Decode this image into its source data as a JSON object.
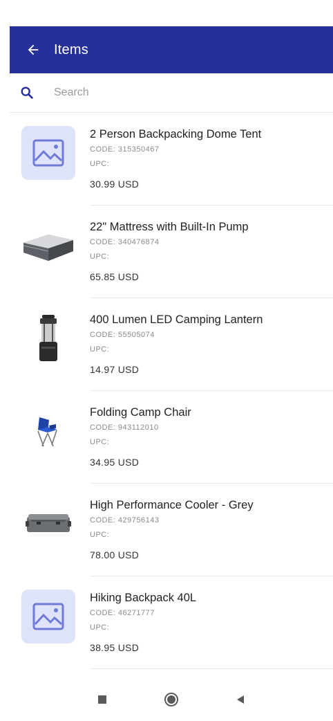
{
  "app_bar": {
    "title": "Items"
  },
  "search": {
    "placeholder": "Search"
  },
  "items": [
    {
      "name": "2 Person Backpacking Dome Tent",
      "code": "CODE: 315350467",
      "upc": "UPC:",
      "price": "30.99 USD",
      "image": "placeholder-image-icon"
    },
    {
      "name": "22\" Mattress with Built-In Pump",
      "code": "CODE: 340476874",
      "upc": "UPC:",
      "price": "65.85 USD",
      "image": "mattress-photo"
    },
    {
      "name": "400 Lumen LED Camping Lantern",
      "code": "CODE: 55505074",
      "upc": "UPC:",
      "price": "14.97 USD",
      "image": "lantern-photo"
    },
    {
      "name": "Folding Camp Chair",
      "code": "CODE: 943112010",
      "upc": "UPC:",
      "price": "34.95 USD",
      "image": "chair-photo"
    },
    {
      "name": "High Performance Cooler - Grey",
      "code": "CODE: 429756143",
      "upc": "UPC:",
      "price": "78.00 USD",
      "image": "cooler-photo"
    },
    {
      "name": "Hiking Backpack 40L",
      "code": "CODE: 46271777",
      "upc": "UPC:",
      "price": "38.95 USD",
      "image": "placeholder-image-icon"
    }
  ],
  "colors": {
    "app_bar": "#26309a",
    "placeholder_bg": "#dfe3fa",
    "placeholder_icon": "#6f7ad6"
  }
}
